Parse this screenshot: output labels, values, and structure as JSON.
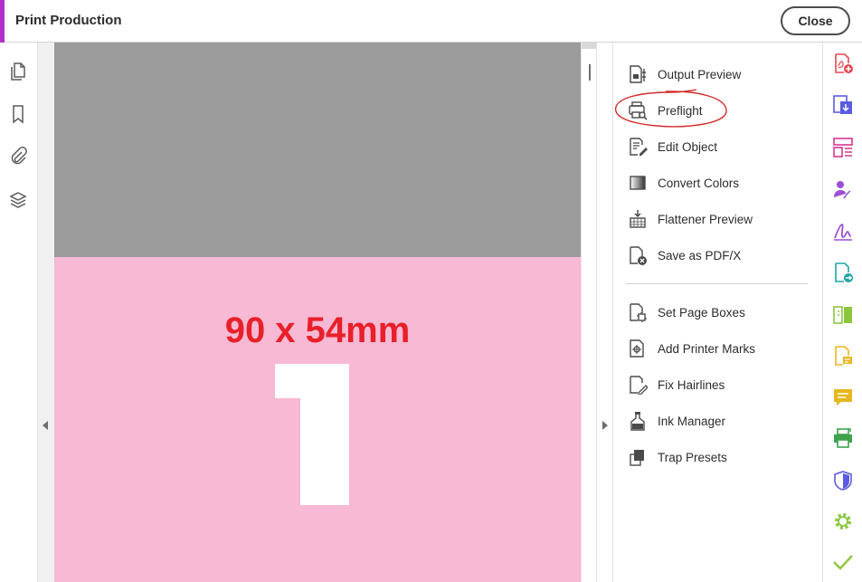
{
  "app": {
    "title": "Print Production",
    "close_label": "Close",
    "accent_color": "#b030c9"
  },
  "left_rail": {
    "icons": [
      "pages-icon",
      "bookmark-icon",
      "attachment-icon",
      "layers-icon"
    ]
  },
  "document": {
    "label": "90 x 54mm",
    "big_numeral": "1",
    "top_color": "#9b9b9b",
    "bottom_color": "#f7b9d4",
    "label_color": "#e8202a"
  },
  "tools_panel": {
    "group1": [
      {
        "label": "Output Preview",
        "icon": "output-preview-icon"
      },
      {
        "label": "Preflight",
        "icon": "preflight-icon",
        "annotated": true
      },
      {
        "label": "Edit Object",
        "icon": "edit-object-icon"
      },
      {
        "label": "Convert Colors",
        "icon": "convert-colors-icon"
      },
      {
        "label": "Flattener Preview",
        "icon": "flattener-preview-icon"
      },
      {
        "label": "Save as PDF/X",
        "icon": "save-pdfx-icon"
      }
    ],
    "group2": [
      {
        "label": "Set Page Boxes",
        "icon": "set-page-boxes-icon"
      },
      {
        "label": "Add Printer Marks",
        "icon": "printer-marks-icon"
      },
      {
        "label": "Fix Hairlines",
        "icon": "fix-hairlines-icon"
      },
      {
        "label": "Ink Manager",
        "icon": "ink-manager-icon"
      },
      {
        "label": "Trap Presets",
        "icon": "trap-presets-icon"
      }
    ],
    "annotation_color": "#d42a2a"
  },
  "right_rail": {
    "icons": [
      {
        "name": "create-pdf-icon",
        "color": "#e34850"
      },
      {
        "name": "export-pdf-icon",
        "color": "#5c5ce0"
      },
      {
        "name": "organize-pages-icon",
        "color": "#d83790"
      },
      {
        "name": "request-signatures-icon",
        "color": "#9b4fd6"
      },
      {
        "name": "fill-sign-icon",
        "color": "#9b4fd6"
      },
      {
        "name": "send-review-icon",
        "color": "#1fa3a3"
      },
      {
        "name": "compare-files-icon",
        "color": "#8cc63f"
      },
      {
        "name": "edit-pdf-icon",
        "color": "#e8b71e"
      },
      {
        "name": "comment-icon",
        "color": "#e8b71e"
      },
      {
        "name": "print-production-icon",
        "color": "#3fa34d"
      },
      {
        "name": "protect-icon",
        "color": "#5c5ce0"
      },
      {
        "name": "optimize-icon",
        "color": "#8cc63f"
      },
      {
        "name": "certificates-icon",
        "color": "#8cc63f"
      }
    ]
  }
}
